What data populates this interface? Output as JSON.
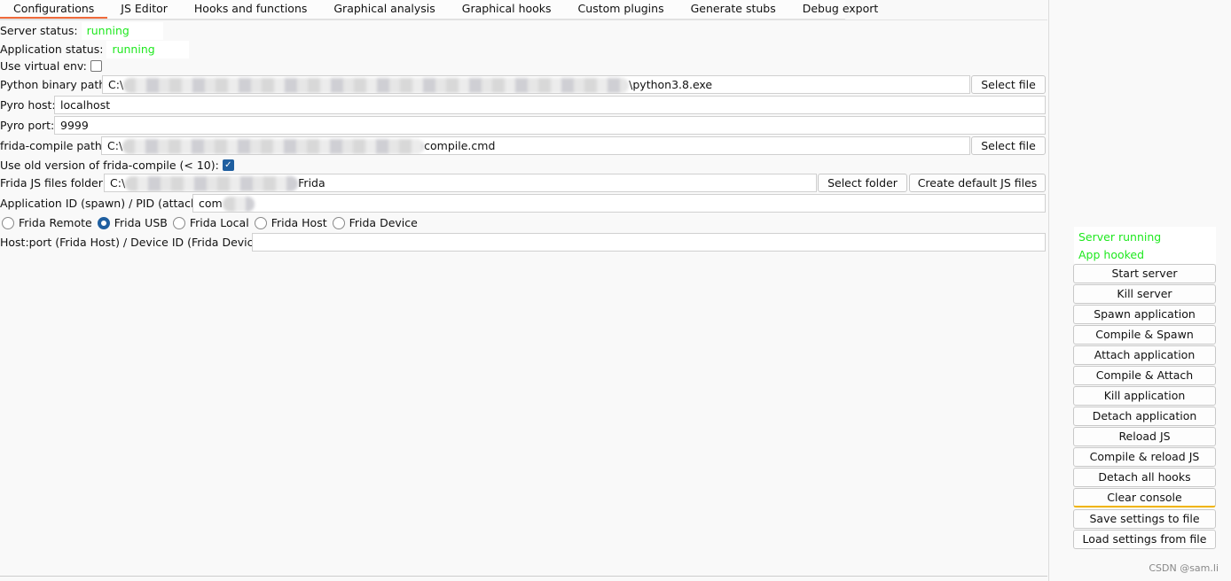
{
  "tabs": [
    "Configurations",
    "JS Editor",
    "Hooks and functions",
    "Graphical analysis",
    "Graphical hooks",
    "Custom plugins",
    "Generate stubs",
    "Debug export"
  ],
  "active_tab": "Configurations",
  "config": {
    "server_status_label": "Server status:",
    "server_status": "running",
    "app_status_label": "Application status:",
    "app_status": "running",
    "venv_label": "Use virtual env:",
    "venv_checked": false,
    "python_label": "Python binary path:",
    "python_prefix": "C:\\",
    "python_suffix": "\\python3.8.exe",
    "pyro_host_label": "Pyro host:",
    "pyro_host": "localhost",
    "pyro_port_label": "Pyro port:",
    "pyro_port": "9999",
    "frida_compile_label": "frida-compile path:",
    "frida_compile_prefix": "C:\\",
    "frida_compile_suffix": "compile.cmd",
    "old_version_label": "Use old version of frida-compile (< 10):",
    "old_version_checked": true,
    "js_folder_label": "Frida JS files folder:",
    "js_folder_prefix": "C:\\",
    "js_folder_suffix": "Frida",
    "app_id_label": "Application ID (spawn) / PID (attach):",
    "app_id_prefix": "com",
    "radios": [
      "Frida Remote",
      "Frida USB",
      "Frida Local",
      "Frida Host",
      "Frida Device"
    ],
    "selected_radio": "Frida USB",
    "hostport_label": "Host:port (Frida Host) / Device ID (Frida Device):",
    "hostport": "",
    "select_file": "Select file",
    "select_folder": "Select folder",
    "create_js": "Create default JS files"
  },
  "side": {
    "status1": "Server running",
    "status2": "App hooked",
    "buttons": [
      "Start server",
      "Kill server",
      "Spawn application",
      "Compile & Spawn",
      "Attach application",
      "Compile & Attach",
      "Kill application",
      "Detach application",
      "Reload JS",
      "Compile & reload JS",
      "Detach all hooks",
      "Clear console",
      "Save settings to file",
      "Load settings from file"
    ]
  },
  "colors": {
    "status_green": "#1ee81e",
    "accent": "#f06a3b",
    "check_blue": "#1f5fa0"
  },
  "watermark": "CSDN @sam.li"
}
